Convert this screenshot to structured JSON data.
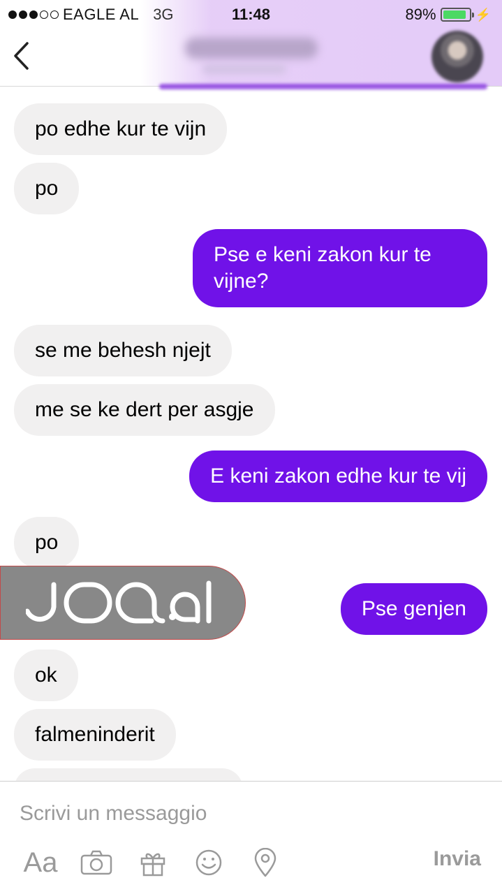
{
  "status_bar": {
    "carrier": "EAGLE AL",
    "network": "3G",
    "time": "11:48",
    "battery": "89%",
    "battery_level": 0.89
  },
  "header": {
    "back_icon": "chevron-left-icon",
    "contact_name": "",
    "contact_status": ""
  },
  "messages": [
    {
      "side": "in",
      "text": "po edhe kur te vijn"
    },
    {
      "side": "in",
      "text": "po"
    },
    {
      "side": "out",
      "text": "Pse e keni zakon kur te vijne?"
    },
    {
      "side": "in",
      "text": "se me behesh njejt"
    },
    {
      "side": "in",
      "text": "me se ke dert per asgje"
    },
    {
      "side": "out",
      "text": "E keni zakon edhe kur te vij"
    },
    {
      "side": "in",
      "text": "po"
    },
    {
      "side": "out",
      "text": "Pse genjen"
    },
    {
      "side": "in",
      "text": "ok"
    },
    {
      "side": "in",
      "text": "falmeninderit"
    }
  ],
  "watermark": {
    "text": "JOQ.al"
  },
  "composer": {
    "placeholder": "Scrivi un messaggio",
    "value": "",
    "text_format_label": "Aa",
    "send_label": "Invia",
    "tools": [
      "camera-icon",
      "gift-icon",
      "smiley-icon",
      "location-pin-icon"
    ]
  },
  "colors": {
    "outgoing_bubble": "#7012e8",
    "incoming_bubble": "#f1f0f0",
    "header_tint": "#e2c8f8",
    "toolbar_gray": "#9a9a9a"
  }
}
